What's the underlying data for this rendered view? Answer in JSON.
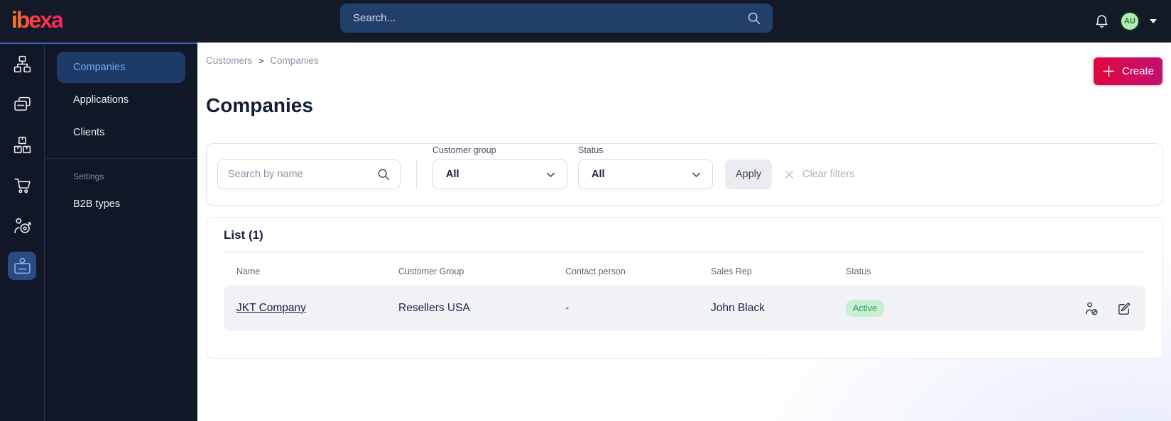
{
  "topbar": {
    "logo_text": "ibexa",
    "search_placeholder": "Search...",
    "avatar_initials": "AU"
  },
  "sidebar": {
    "rail_icons": [
      "content-tree",
      "applications",
      "products",
      "cart",
      "customer-segments",
      "companies"
    ],
    "active_rail_icon": "companies",
    "menu": {
      "items": [
        {
          "label": "Companies",
          "active": true
        },
        {
          "label": "Applications",
          "active": false
        },
        {
          "label": "Clients",
          "active": false
        }
      ],
      "section_label": "Settings",
      "section_items": [
        {
          "label": "B2B types",
          "active": false
        }
      ]
    }
  },
  "breadcrumb": {
    "items": [
      "Customers",
      "Companies"
    ],
    "separator": ">"
  },
  "page": {
    "title": "Companies",
    "create_label": "Create"
  },
  "filters": {
    "search_placeholder": "Search by name",
    "fields": [
      {
        "label": "Customer group",
        "value": "All"
      },
      {
        "label": "Status",
        "value": "All"
      }
    ],
    "apply_label": "Apply",
    "clear_label": "Clear filters"
  },
  "list": {
    "title": "List (1)",
    "columns": [
      "Name",
      "Customer Group",
      "Contact person",
      "Sales Rep",
      "Status"
    ],
    "rows": [
      {
        "name": "JKT Company",
        "customer_group": "Resellers USA",
        "contact_person": "-",
        "sales_rep": "John Black",
        "status": "Active"
      }
    ]
  },
  "colors": {
    "topbar_bg": "#141928",
    "sidebar_accent_line": "#3c69ad",
    "active_menu_text": "#74a7f3",
    "create_gradient_start": "#e2063e",
    "create_gradient_end": "#c01170",
    "status_active_bg": "#c8efd4",
    "status_active_text": "#2da356",
    "avatar_bg": "#b7e7b4"
  }
}
